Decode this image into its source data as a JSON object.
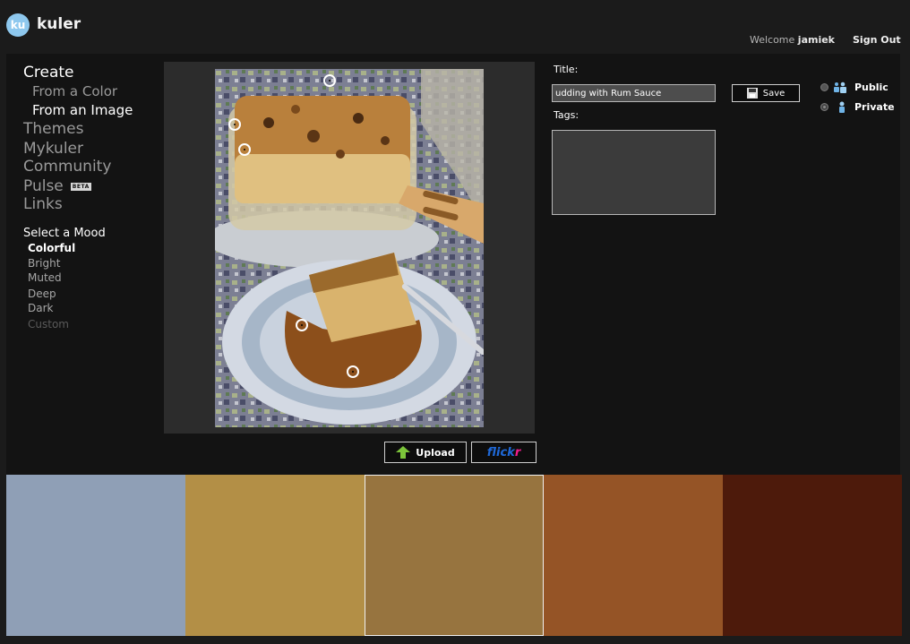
{
  "header": {
    "logo_badge": "ku",
    "logo_text": "kuler",
    "welcome_prefix": "Welcome",
    "username": "jamiek",
    "sign_out": "Sign Out"
  },
  "nav": {
    "create": "Create",
    "from_color": "From a Color",
    "from_image": "From an Image",
    "themes": "Themes",
    "mykuler": "Mykuler",
    "community": "Community",
    "pulse": "Pulse",
    "beta": "BETA",
    "links": "Links"
  },
  "mood": {
    "title": "Select a Mood",
    "options": [
      "Colorful",
      "Bright",
      "Muted",
      "Deep",
      "Dark",
      "Custom"
    ],
    "selected": "Colorful"
  },
  "image_actions": {
    "upload": "Upload",
    "flickr_a": "flick",
    "flickr_b": "r"
  },
  "form": {
    "title_label": "Title:",
    "title_value": "udding with Rum Sauce",
    "tags_label": "Tags:",
    "tags_value": "",
    "save_label": "Save",
    "public_label": "Public",
    "private_label": "Private",
    "visibility": "private"
  },
  "swatches": [
    {
      "color": "#8f9fb6"
    },
    {
      "color": "#b38f46"
    },
    {
      "color": "#97743f",
      "selected": true
    },
    {
      "color": "#955426"
    },
    {
      "color": "#4d1a0b"
    }
  ],
  "icons": {
    "upload": "upload-arrow-icon",
    "save": "floppy-disk-icon",
    "public": "group-icon",
    "private": "person-icon",
    "picker": "color-picker-circle-icon"
  }
}
